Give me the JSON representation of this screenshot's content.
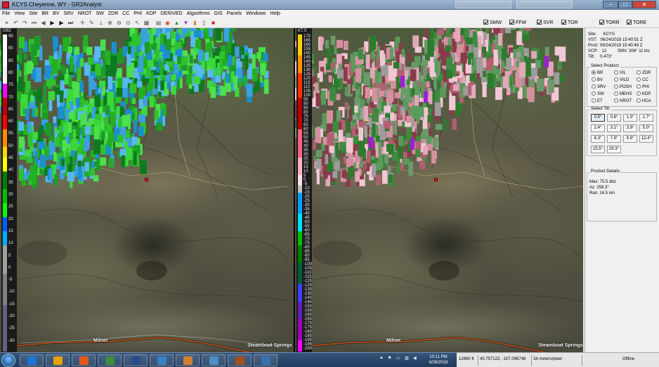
{
  "window": {
    "title": "KCYS Cheyenne, WY - GR2Analyst",
    "min_glyph": "–",
    "max_glyph": "□",
    "close_glyph": "✕"
  },
  "menu": [
    "File",
    "View",
    "Site",
    "BR",
    "BV",
    "SRV",
    "NROT",
    "SW",
    "ZDR",
    "CC",
    "PHI",
    "KDP",
    "DERIVED",
    "Algorithms",
    "GIS",
    "Panels",
    "Windows",
    "Help"
  ],
  "toolbar": {
    "icons": [
      "link-icon",
      "undo-icon",
      "redo-icon",
      "skip-back-icon",
      "step-back-icon",
      "play-icon",
      "step-forward-icon",
      "skip-forward-icon",
      "crosshair-icon",
      "pen-icon",
      "measure-icon",
      "zoom-in-icon",
      "zoom-out-icon",
      "zoom-fit-icon",
      "pointer-icon",
      "grid-icon",
      "layers-icon",
      "color-icon",
      "triangle-green-icon",
      "triangle-purple-icon",
      "book-icon",
      "doc-icon",
      "stop-icon"
    ],
    "product_checks": [
      {
        "label": "SMW",
        "checked": true
      },
      {
        "label": "FFW",
        "checked": true
      },
      {
        "label": "SVR",
        "checked": true
      },
      {
        "label": "TOR",
        "checked": true
      },
      {
        "label": "TORR",
        "checked": true
      },
      {
        "label": "TORE",
        "checked": true
      }
    ]
  },
  "left_panel": {
    "unit": "DBZ",
    "ticks": [
      "95",
      "90",
      "85",
      "80",
      "75",
      "70",
      "65",
      "60",
      "55",
      "50",
      "45",
      "40",
      "35",
      "30",
      "25",
      "20",
      "15",
      "10",
      "5",
      "0",
      "-5",
      "-10",
      "-15",
      "-20",
      "-25",
      "-30"
    ]
  },
  "right_panel": {
    "unit": "KT.S",
    "ticks": [
      "170",
      "165",
      "160",
      "155",
      "150",
      "145",
      "140",
      "135",
      "130",
      "125",
      "120",
      "115",
      "110",
      "105",
      "100",
      "95",
      "90",
      "85",
      "80",
      "75",
      "70",
      "65",
      "60",
      "55",
      "50",
      "45",
      "40",
      "35",
      "30",
      "25",
      "20",
      "15",
      "10",
      "5",
      "0",
      "-5",
      "-10",
      "-15",
      "-20",
      "-25",
      "-30",
      "-35",
      "-40",
      "-45",
      "-50",
      "-55",
      "-60",
      "-65",
      "-70",
      "-75",
      "-80",
      "-85",
      "-90",
      "-95",
      "-100",
      "-105",
      "-110",
      "-115",
      "-120",
      "-125",
      "-130",
      "-135",
      "-140",
      "-145",
      "-150",
      "-155",
      "-160",
      "-165",
      "-170",
      "-175",
      "-180",
      "-185",
      "-190",
      "-195",
      "-200"
    ]
  },
  "map_labels": {
    "milner": "Milner",
    "steamboat": "Steamboat Springs"
  },
  "sidebar": {
    "site_label": "Site:",
    "site_value": "KCYS",
    "vst_label": "VST:",
    "vst_value": "06/24/2018  15:40:51 Z",
    "prod_label": "Prod:",
    "prod_value": "06/24/2018  15:40:49 Z",
    "vcp_label": "VCP:",
    "vcp_value": "12",
    "smv_value": "SMV: 306° 11 kts",
    "tilt_label": "Tilt:",
    "tilt_value": "0.473°",
    "select_product_label": "Select Product:",
    "products": [
      {
        "label": "BR",
        "selected": true
      },
      {
        "label": "VIL",
        "selected": false
      },
      {
        "label": "ZDR",
        "selected": false
      },
      {
        "label": "BV",
        "selected": false
      },
      {
        "label": "VILD",
        "selected": false
      },
      {
        "label": "CC",
        "selected": false
      },
      {
        "label": "SRV",
        "selected": false
      },
      {
        "label": "POSH",
        "selected": false
      },
      {
        "label": "PHI",
        "selected": false
      },
      {
        "label": "SW",
        "selected": false
      },
      {
        "label": "MEHS",
        "selected": false
      },
      {
        "label": "KDP",
        "selected": false
      },
      {
        "label": "ET",
        "selected": false
      },
      {
        "label": "NROT",
        "selected": false
      },
      {
        "label": "HCA",
        "selected": false
      }
    ],
    "select_tilt_label": "Select Tilt:",
    "tilts": [
      {
        "label": "0.5°",
        "selected": true
      },
      {
        "label": "0.8°",
        "selected": false
      },
      {
        "label": "1.3°",
        "selected": false
      },
      {
        "label": "1.7°",
        "selected": false
      },
      {
        "label": "2.4°",
        "selected": false
      },
      {
        "label": "3.1°",
        "selected": false
      },
      {
        "label": "3.9°",
        "selected": false
      },
      {
        "label": "5.0°",
        "selected": false
      },
      {
        "label": "6.3°",
        "selected": false
      },
      {
        "label": "7.9°",
        "selected": false
      },
      {
        "label": "9.9°",
        "selected": false
      },
      {
        "label": "12.4°",
        "selected": false
      },
      {
        "label": "15.5°",
        "selected": false
      },
      {
        "label": "19.3°",
        "selected": false
      }
    ],
    "details_label": "Product Details:",
    "max_value": "Max:  75.5 dbz",
    "az_value": "Az:   258.3°",
    "ran_value": "Ran:  14.5 nm"
  },
  "taskbar": {
    "items": [
      "start-orb",
      "ie-icon",
      "chrome-icon",
      "firefox-icon",
      "notepad-icon",
      "gr2analyst-icon",
      "paint-icon",
      "photos-icon",
      "pen-tool-icon",
      "remote-icon",
      "powerpoint-icon"
    ],
    "time": "10:11 PM",
    "date": "6/26/2018"
  },
  "status": {
    "elevation": "12860 ft",
    "coords": "40.757122, -107.096748",
    "scale": "34 meters/pixel",
    "connection": "Offline"
  },
  "colors": {
    "accent_window": "#7f9bbb",
    "reflectivity_green": "#2ec22e",
    "velocity_green": "#3f8a3f",
    "velocity_pink": "#e2a8b8",
    "velocity_purple": "#9b1fd6",
    "highway": "#b5501a"
  }
}
